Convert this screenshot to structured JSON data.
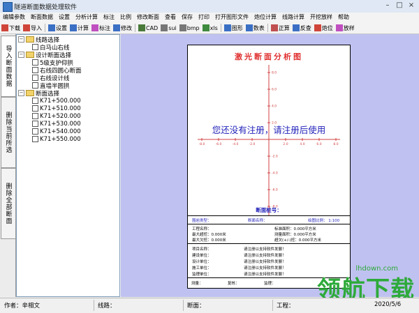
{
  "window": {
    "title": "隧道断面数据处理软件"
  },
  "menu": [
    "编辑参数",
    "断面数据",
    "设置",
    "分析计算",
    "标注",
    "比例",
    "修改断面",
    "查看",
    "保存",
    "打印",
    "打开图形文件",
    "炮位计算",
    "线路计算",
    "开挖放样",
    "帮助"
  ],
  "toolbar": [
    {
      "label": "下载",
      "icon": "download-icon",
      "color": "#d0453a"
    },
    {
      "label": "导入",
      "icon": "import-icon",
      "color": "#d0453a"
    },
    {
      "label": "设置",
      "icon": "settings-icon",
      "color": "#3b6fc4"
    },
    {
      "label": "计算",
      "icon": "calc-icon",
      "color": "#3b6fc4"
    },
    {
      "label": "标注",
      "icon": "label-icon",
      "color": "#c04fbf"
    },
    {
      "label": "修改",
      "icon": "edit-icon",
      "color": "#3b6fc4"
    },
    {
      "label": "CAD",
      "icon": "cad-icon",
      "color": "#4a7a3a"
    },
    {
      "label": "sui",
      "icon": "sui-icon",
      "color": "#777777"
    },
    {
      "label": "bmp",
      "icon": "bmp-icon",
      "color": "#777777"
    },
    {
      "label": "xls",
      "icon": "xls-icon",
      "color": "#3e8a3e"
    },
    {
      "label": "图形",
      "icon": "graph-icon",
      "color": "#3b6fc4"
    },
    {
      "label": "数表",
      "icon": "table-icon",
      "color": "#3b6fc4"
    },
    {
      "label": "正算",
      "icon": "forward-calc-icon",
      "color": "#c04f4f"
    },
    {
      "label": "反查",
      "icon": "reverse-icon",
      "color": "#3b6fc4"
    },
    {
      "label": "炮位",
      "icon": "blast-icon",
      "color": "#d0453a"
    },
    {
      "label": "放样",
      "icon": "stakeout-icon",
      "color": "#c04fbf"
    }
  ],
  "side_tabs": [
    "导入断面数据",
    "删除当前所选",
    "删除全部断面"
  ],
  "tree": {
    "route_group": "线路选择",
    "route_items": [
      "白马山右线"
    ],
    "design_group": "设计断面选择",
    "design_items": [
      "5级支护仰拱",
      "右线四圆心断面",
      "右线设计线",
      "直墙半圆拱"
    ],
    "section_group": "断面选择",
    "section_items": [
      "K71+500.000",
      "K71+510.000",
      "K71+520.000",
      "K71+530.000",
      "K71+540.000",
      "K71+550.000"
    ]
  },
  "paper": {
    "title": "激光断面分析图",
    "notice": "您还没有注册，请注册后使用",
    "section_no_label": "断面桩号：",
    "row1": {
      "left": "围岩类型：",
      "mid": "断面名称：",
      "right": "绘图比例： 1:100"
    },
    "info_left": [
      "工程名称：",
      "最大超挖：0.000米",
      "最大欠挖：0.000米"
    ],
    "info_right": [
      "标准面积：0.000平方米",
      "测量面积：0.000平方米",
      "超欠(+/-)挖：0.000平方米"
    ],
    "project_rows": [
      {
        "k": "项目名称：",
        "v": "请注册以支持软件发展！"
      },
      {
        "k": "建设单位：",
        "v": "请注册以支持软件发展！"
      },
      {
        "k": "设计单位：",
        "v": "请注册以支持软件发展！"
      },
      {
        "k": "施工单位：",
        "v": "请注册以支持软件发展！"
      },
      {
        "k": "监理单位：",
        "v": "请注册以支持软件发展！"
      }
    ],
    "sign": [
      "测量：",
      "复核：",
      "监理："
    ],
    "tick_x": [
      "-8.0",
      "-6.0",
      "-4.0",
      "-2.0",
      "2.0",
      "4.0",
      "6.0",
      "8.0"
    ],
    "tick_y": [
      "8.0",
      "6.0",
      "4.0",
      "2.0",
      "-2.0",
      "-4.0",
      "-6.0",
      "-8.0"
    ]
  },
  "status": {
    "author": "作者：辛相文",
    "route": "线路：",
    "section": "断面：",
    "project": "工程：",
    "date": "2020/5/6"
  },
  "brand": {
    "text": "领航下载",
    "url": "lhdown.com"
  }
}
